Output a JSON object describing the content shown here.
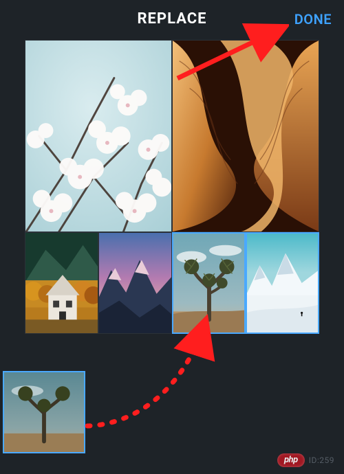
{
  "header": {
    "title": "REPLACE",
    "done_label": "DONE"
  },
  "collage": {
    "tiles": [
      {
        "id": "blossom",
        "name": "tile-cherry-blossom",
        "selected": false
      },
      {
        "id": "canyon",
        "name": "tile-canyon",
        "selected": false
      },
      {
        "id": "cabin",
        "name": "tile-cabin",
        "selected": false
      },
      {
        "id": "mountain",
        "name": "tile-mountain-sunset",
        "selected": false
      },
      {
        "id": "joshua",
        "name": "tile-joshua-tree",
        "selected": true
      },
      {
        "id": "snow",
        "name": "tile-snow-peak",
        "selected": true
      }
    ]
  },
  "source": {
    "name": "source-thumbnail-joshua-tree",
    "selected": true
  },
  "annotations": {
    "arrow_to_done": true,
    "dashed_arrow_to_tile": true
  },
  "watermark": {
    "brand": "php",
    "code": "ID:259"
  },
  "colors": {
    "accent": "#3ea2ff",
    "selection": "#4aa9ff",
    "annotation": "#ff1e1e",
    "background": "#1e2328"
  }
}
